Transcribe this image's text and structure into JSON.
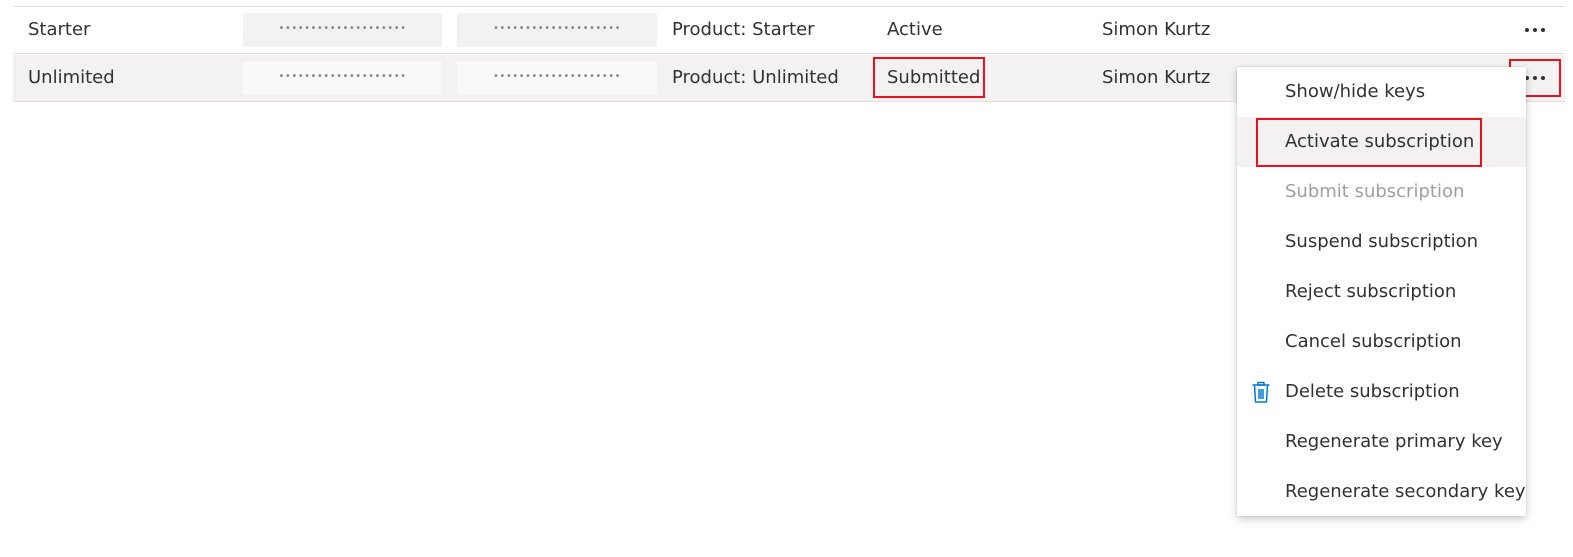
{
  "rows": [
    {
      "name": "Starter",
      "primary_key": "••••••••••••••••••••",
      "secondary_key": "••••••••••••••••••••",
      "scope": "Product: Starter",
      "state": "Active",
      "owner": "Simon Kurtz"
    },
    {
      "name": "Unlimited",
      "primary_key": "••••••••••••••••••••",
      "secondary_key": "••••••••••••••••••••",
      "scope": "Product: Unlimited",
      "state": "Submitted",
      "owner": "Simon Kurtz"
    }
  ],
  "context_menu": {
    "items": [
      {
        "label": "Show/hide keys",
        "enabled": true
      },
      {
        "label": "Activate subscription",
        "enabled": true,
        "hovered": true,
        "highlighted": true
      },
      {
        "label": "Submit subscription",
        "enabled": false
      },
      {
        "label": "Suspend subscription",
        "enabled": true
      },
      {
        "label": "Reject subscription",
        "enabled": true
      },
      {
        "label": "Cancel subscription",
        "enabled": true
      },
      {
        "label": "Delete subscription",
        "enabled": true,
        "icon": "trash-icon"
      },
      {
        "label": "Regenerate primary key",
        "enabled": true
      },
      {
        "label": "Regenerate secondary key",
        "enabled": true
      }
    ]
  },
  "colors": {
    "highlight_border": "#e8111f",
    "icon_accent": "#0078d4",
    "disabled_text": "#a19f9d",
    "selected_row_bg": "#f3f2f1"
  }
}
